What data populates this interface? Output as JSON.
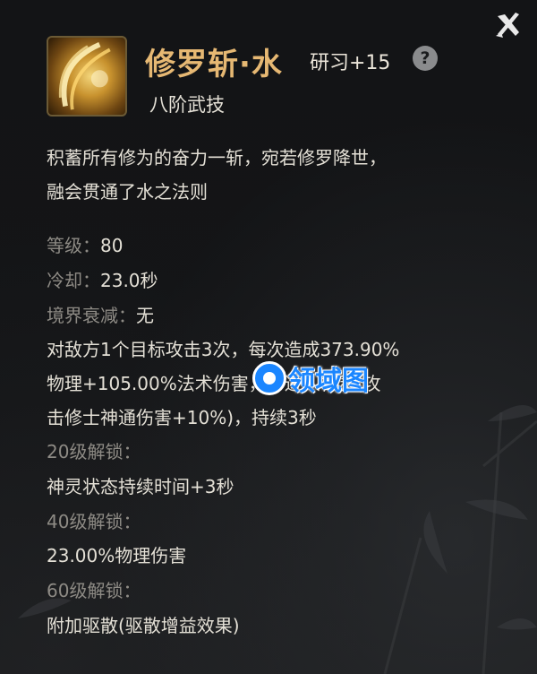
{
  "skill": {
    "name": "修罗斩·水",
    "study": "研习+15",
    "help": "?",
    "tier": "八阶武技",
    "description": [
      "积蓄所有修为的奋力一斩，宛若修罗降世，",
      "融会贯通了水之法则"
    ]
  },
  "stats": {
    "level_label": "等级：",
    "level_value": "80",
    "cooldown_label": "冷却：",
    "cooldown_value": "23.0秒",
    "realm_label": "境界衰减：",
    "realm_value": "无"
  },
  "effect": [
    "对敌方1个目标攻击3次，每次造成373.90%",
    "物理+105.00%法术伤害，并进入神灵(攻",
    "击修士神通伤害+10%)，持续3秒"
  ],
  "unlocks": [
    {
      "label": "20级解锁：",
      "text": "神灵状态持续时间+3秒"
    },
    {
      "label": "40级解锁：",
      "text": "23.00%物理伤害"
    },
    {
      "label": "60级解锁：",
      "text": "附加驱散(驱散增益效果)"
    }
  ],
  "watermark": {
    "text": "领域图"
  },
  "colors": {
    "title": "#e6b873",
    "label": "#8e8b85",
    "text": "#e4e0d6",
    "background": "#141517",
    "watermark": "#1b86ff"
  },
  "icons": {
    "close": "close-x-icon",
    "help": "question-icon",
    "skill": "golden-slash-icon"
  }
}
